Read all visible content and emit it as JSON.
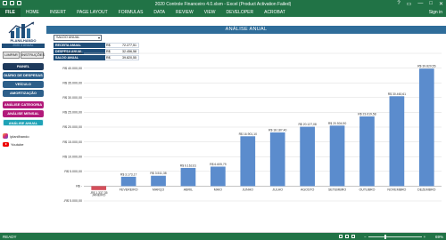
{
  "window": {
    "title": "2020 Controle Financeiro 4.0.xlsm - Excel (Product Activation Failed)",
    "controls": {
      "help": "?",
      "restore": "▭",
      "minimize": "—",
      "maximize": "□",
      "close": "✕"
    }
  },
  "ribbon": {
    "file": "FILE",
    "tabs": [
      "HOME",
      "INSERT",
      "PAGE LAYOUT",
      "FORMULAS",
      "DATA",
      "REVIEW",
      "VIEW",
      "DEVELOPER",
      "ACROBAT"
    ],
    "signin": "Sign in"
  },
  "sidebar": {
    "logo_text": "PLANILHANDO",
    "version": "2020 3 ANUAL",
    "limpar": "LIMPAR",
    "instrucoes": "INSTRUÇÕES",
    "nav": [
      {
        "label": "PAINEL",
        "style": "dark"
      },
      {
        "label": "DIÁRIO DE DESPESAS",
        "style": "blue"
      },
      {
        "label": "VEÍCULO",
        "style": "blue"
      },
      {
        "label": "AMORTIZAÇÃO",
        "style": "blue"
      },
      {
        "label": "ANÁLISE CATEGORIA",
        "style": "pink"
      },
      {
        "label": "ANÁLISE MENSAL",
        "style": "pink"
      },
      {
        "label": "ANÁLISE ANUAL",
        "style": "teal"
      }
    ],
    "social": [
      {
        "icon": "instagram-icon",
        "label": "/planilhando"
      },
      {
        "icon": "youtube-icon",
        "label": "Youtube"
      }
    ]
  },
  "main": {
    "header": "ANÁLISE ANUAL",
    "dropdown_value": "SALDO ANUAL",
    "summary": [
      {
        "label": "RECEITA ANUAL",
        "currency": "R$",
        "value": "72.277,51"
      },
      {
        "label": "DESPESA ANUAL",
        "currency": "R$",
        "value": "32.456,58"
      },
      {
        "label": "SALDO ANUAL",
        "currency": "R$",
        "value": "39.820,55"
      }
    ]
  },
  "chart_data": {
    "type": "bar",
    "title": "",
    "xlabel": "",
    "ylabel": "",
    "ylim": [
      -5000,
      45000
    ],
    "yticks": [
      {
        "value": -5000,
        "label": "-R$ 5.000,00"
      },
      {
        "value": 0,
        "label": "R$ -"
      },
      {
        "value": 5000,
        "label": "R$ 5.000,00"
      },
      {
        "value": 10000,
        "label": "R$ 10.000,00"
      },
      {
        "value": 15000,
        "label": "R$ 15.000,00"
      },
      {
        "value": 20000,
        "label": "R$ 20.000,00"
      },
      {
        "value": 25000,
        "label": "R$ 25.000,00"
      },
      {
        "value": 30000,
        "label": "R$ 30.000,00"
      },
      {
        "value": 35000,
        "label": "R$ 35.000,00"
      },
      {
        "value": 40000,
        "label": "R$ 40.000,00"
      },
      {
        "value": 45000,
        "label": "R$ 45.000,00"
      }
    ],
    "categories": [
      "JANEIRO",
      "FEVEREIRO",
      "MARÇO",
      "ABRIL",
      "MAIO",
      "JUNHO",
      "JULHO",
      "AGOSTO",
      "SETEMBRO",
      "OUTUBRO",
      "NOVEMBRO",
      "DEZEMBRO"
    ],
    "values": [
      -1337.35,
      3173.17,
      3511.38,
      6162.61,
      6605.79,
      16901.1,
      18187.4,
      20127.08,
      20504.9,
      23619.58,
      30460.61,
      39820.55
    ],
    "data_labels": [
      "-R$ 1.337,35",
      "R$ 3.173,17",
      "R$ 3.511,38",
      "R$ 6.162,61",
      "R$ 6.605,79",
      "R$ 16.901,10",
      "R$ 18.187,40",
      "R$ 20.127,08",
      "R$ 20.504,90",
      "R$ 23.619,58",
      "R$ 30.460,61",
      "R$ 39.820,55"
    ],
    "colors": {
      "positive": "#5b8ccd",
      "negative": "#d44f5b"
    },
    "grid": true,
    "legend": false
  },
  "status": {
    "ready": "READY",
    "zoom": "69%",
    "zoom_minus": "−",
    "zoom_plus": "+",
    "zoom_level": 0.69
  },
  "colors": {
    "excel_green": "#217346",
    "header_blue": "#2f6d9a",
    "nav_dark": "#1e3a5c",
    "nav_pink": "#b21a7a",
    "nav_teal": "#1fa2b6"
  }
}
